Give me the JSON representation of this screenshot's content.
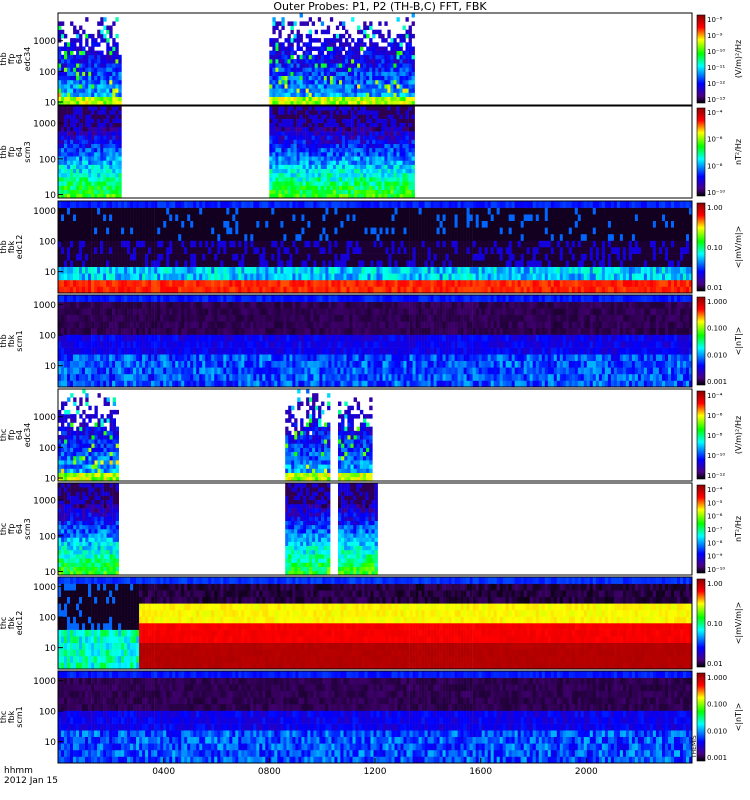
{
  "chart_data": {
    "type": "heatmap",
    "title": "Outer Probes: P1, P2 (TH-B,C) FFT, FBK",
    "time_axis": {
      "range_hours": [
        0,
        24
      ],
      "tick_labels": [
        "0400",
        "0800",
        "1200",
        "1600",
        "2000"
      ],
      "tick_hours": [
        4,
        8,
        12,
        16,
        20
      ],
      "footer_line1": "hhmm",
      "footer_line2": "2012 Jan 15"
    },
    "side_text": "THEMIS",
    "panels": [
      {
        "ylabel": [
          "thb",
          "ffp",
          "64",
          "edc34"
        ],
        "yticks": [
          "10",
          "100",
          "1000"
        ],
        "ytick_values": [
          10,
          100,
          1000
        ],
        "yrange": [
          8,
          8000
        ],
        "cbar_label": "(V/m)²/Hz",
        "cbar_ticks": [
          "10⁻¹³",
          "10⁻¹²",
          "10⁻¹¹",
          "10⁻¹⁰",
          "10⁻⁹",
          "10⁻⁸"
        ],
        "colormap": "rainbow",
        "segments": [
          [
            0,
            2.4
          ],
          [
            8,
            13.5
          ]
        ]
      },
      {
        "ylabel": [
          "thb",
          "ffp",
          "64",
          "scm3"
        ],
        "yticks": [
          "10",
          "100",
          "1000"
        ],
        "ytick_values": [
          10,
          100,
          1000
        ],
        "yrange": [
          8,
          3000
        ],
        "cbar_label": "nT²/Hz",
        "cbar_ticks": [
          "10⁻¹⁰",
          "10⁻⁸",
          "10⁻⁶",
          "10⁻⁴"
        ],
        "colormap": "rainbow",
        "segments": [
          [
            0,
            2.4
          ],
          [
            8,
            13.5
          ]
        ]
      },
      {
        "ylabel": [
          "thb",
          "fbk",
          "edc12"
        ],
        "yticks": [
          "10",
          "100",
          "1000"
        ],
        "ytick_values": [
          10,
          100,
          1000
        ],
        "yrange": [
          2,
          2048
        ],
        "cbar_label": "<|mV/m|>",
        "cbar_ticks": [
          "0.01",
          "0.10",
          "1.00"
        ],
        "colormap": "rainbow",
        "segments": [
          [
            0,
            24
          ]
        ]
      },
      {
        "ylabel": [
          "thb",
          "fbk",
          "scm1"
        ],
        "yticks": [
          "10",
          "100",
          "1000"
        ],
        "ytick_values": [
          10,
          100,
          1000
        ],
        "yrange": [
          2,
          2048
        ],
        "cbar_label": "<|nT|>",
        "cbar_ticks": [
          "0.001",
          "0.010",
          "0.100",
          "1.000"
        ],
        "colormap": "rainbow",
        "segments": [
          [
            0,
            24
          ]
        ]
      },
      {
        "ylabel": [
          "thc",
          "ffp",
          "64",
          "edc34"
        ],
        "yticks": [
          "10",
          "100",
          "1000"
        ],
        "ytick_values": [
          10,
          100,
          1000
        ],
        "yrange": [
          8,
          8000
        ],
        "cbar_label": "(V/m)²/Hz",
        "cbar_ticks": [
          "10⁻¹²",
          "10⁻¹⁰",
          "10⁻⁸",
          "10⁻⁶",
          "10⁻⁴"
        ],
        "colormap": "rainbow",
        "segments": [
          [
            0,
            2.3
          ],
          [
            8.6,
            10.3
          ],
          [
            10.6,
            11.9
          ]
        ]
      },
      {
        "ylabel": [
          "thc",
          "ffp",
          "64",
          "scm3"
        ],
        "yticks": [
          "10",
          "100",
          "1000"
        ],
        "ytick_values": [
          10,
          100,
          1000
        ],
        "yrange": [
          8,
          3000
        ],
        "cbar_label": "nT²/Hz",
        "cbar_ticks": [
          "10⁻¹⁰",
          "10⁻⁹",
          "10⁻⁸",
          "10⁻⁷",
          "10⁻⁶",
          "10⁻⁵",
          "10⁻⁴"
        ],
        "colormap": "rainbow",
        "segments": [
          [
            0,
            2.3
          ],
          [
            8.6,
            10.3
          ],
          [
            10.6,
            12.1
          ]
        ]
      },
      {
        "ylabel": [
          "thc",
          "fbk",
          "edc12"
        ],
        "yticks": [
          "10",
          "100",
          "1000"
        ],
        "ytick_values": [
          10,
          100,
          1000
        ],
        "yrange": [
          2,
          2048
        ],
        "cbar_label": "<|mV/m|>",
        "cbar_ticks": [
          "0.01",
          "0.10",
          "1.00"
        ],
        "colormap": "rainbow",
        "segments": [
          [
            0,
            24
          ]
        ]
      },
      {
        "ylabel": [
          "thc",
          "fbk",
          "scm1"
        ],
        "yticks": [
          "10",
          "100",
          "1000"
        ],
        "ytick_values": [
          10,
          100,
          1000
        ],
        "yrange": [
          2,
          2048
        ],
        "cbar_label": "<|nT|>",
        "cbar_ticks": [
          "0.001",
          "0.010",
          "0.100",
          "1.000"
        ],
        "colormap": "rainbow",
        "segments": [
          [
            0,
            24
          ]
        ]
      }
    ]
  }
}
